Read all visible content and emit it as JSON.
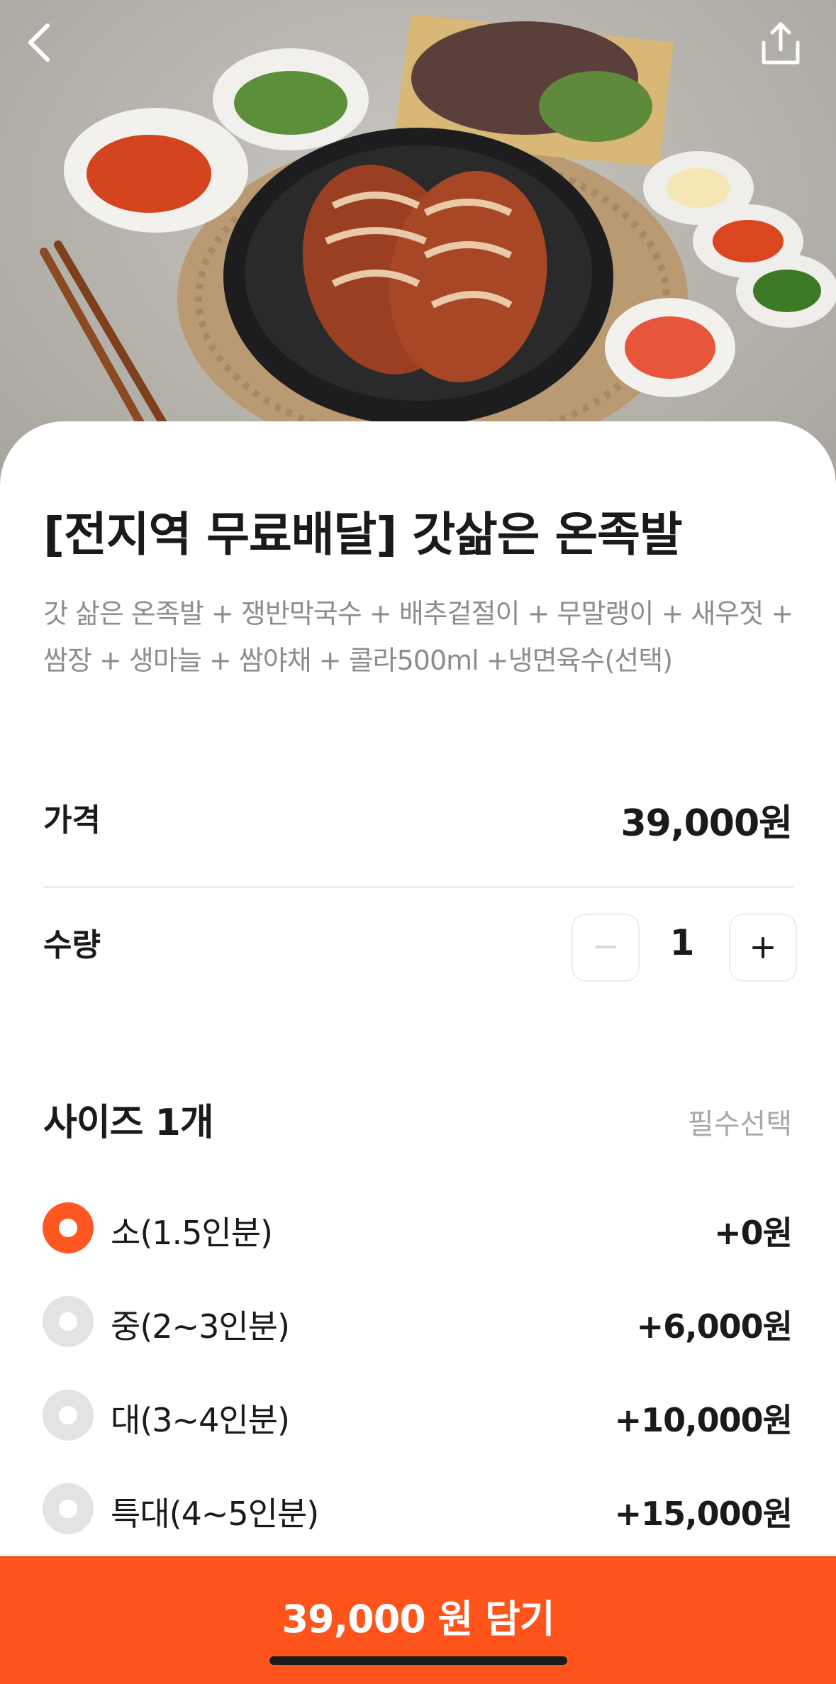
{
  "product": {
    "title": "[전지역 무료배달] 갓삶은 온족발",
    "description": "갓 삶은 온족발 + 쟁반막국수 + 배추겉절이 + 무말랭이 + 새우젓 + 쌈장 + 생마늘 + 쌈야채 + 콜라500ml +냉면육수(선택)"
  },
  "price": {
    "label": "가격",
    "value": "39,000원"
  },
  "quantity": {
    "label": "수량",
    "value": "1",
    "minus": "−",
    "plus": "+"
  },
  "size": {
    "title": "사이즈 1개",
    "required": "필수선택",
    "options": [
      {
        "label": "소(1.5인분)",
        "price": "+0원",
        "selected": true
      },
      {
        "label": "중(2~3인분)",
        "price": "+6,000원",
        "selected": false
      },
      {
        "label": "대(3~4인분)",
        "price": "+10,000원",
        "selected": false
      },
      {
        "label": "특대(4~5인분)",
        "price": "+15,000원",
        "selected": false
      }
    ]
  },
  "cta": {
    "label": "39,000 원 담기"
  },
  "icons": {
    "back": "chevron-left-icon",
    "share": "share-icon"
  },
  "colors": {
    "accent": "#ff541c",
    "radio_selected": "#ff5722",
    "radio_unselected": "#e3e3e3"
  }
}
